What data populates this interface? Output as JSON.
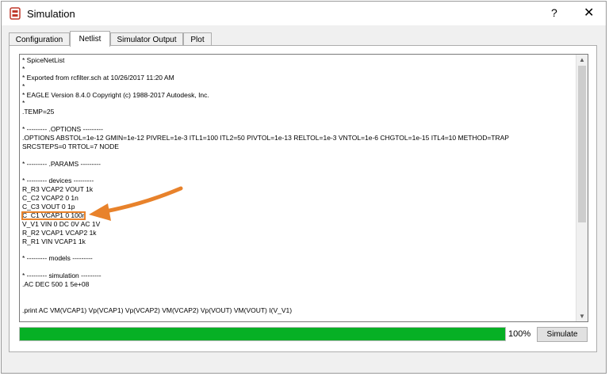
{
  "window": {
    "title": "Simulation",
    "help_glyph": "?",
    "close_glyph": "✕"
  },
  "tabs": [
    {
      "label": "Configuration"
    },
    {
      "label": "Netlist"
    },
    {
      "label": "Simulator Output"
    },
    {
      "label": "Plot"
    }
  ],
  "active_tab": "Netlist",
  "netlist_lines": [
    "* SpiceNetList",
    "*",
    "* Exported from rcfilter.sch at 10/26/2017 11:20 AM",
    "*",
    "* EAGLE Version 8.4.0 Copyright (c) 1988-2017 Autodesk, Inc.",
    "*",
    ".TEMP=25",
    "",
    "* --------- .OPTIONS ---------",
    ".OPTIONS ABSTOL=1e-12 GMIN=1e-12 PIVREL=1e-3 ITL1=100 ITL2=50 PIVTOL=1e-13 RELTOL=1e-3 VNTOL=1e-6 CHGTOL=1e-15 ITL4=10 METHOD=TRAP",
    "SRCSTEPS=0 TRTOL=7 NODE",
    "",
    "* --------- .PARAMS ---------",
    "",
    "* --------- devices ---------",
    "R_R3 VCAP2 VOUT 1k",
    "C_C2 VCAP2 0 1n",
    "C_C3 VOUT 0 1p",
    "C_C1 VCAP1 0 100n",
    "V_V1 VIN 0 DC 0V AC 1V",
    "R_R2 VCAP1 VCAP2 1k",
    "R_R1 VIN VCAP1 1k",
    "",
    "* --------- models ---------",
    "",
    "* --------- simulation ---------",
    ".AC DEC 500 1 5e+08",
    "",
    "",
    ".print AC VM(VCAP1) Vp(VCAP1) Vp(VCAP2) VM(VCAP2) Vp(VOUT) VM(VOUT) I(V_V1)"
  ],
  "progress": {
    "percent": 100,
    "label": "100%"
  },
  "simulate_button": "Simulate",
  "accent": {
    "progress_green": "#06b025",
    "highlight_orange": "#e8822b"
  }
}
